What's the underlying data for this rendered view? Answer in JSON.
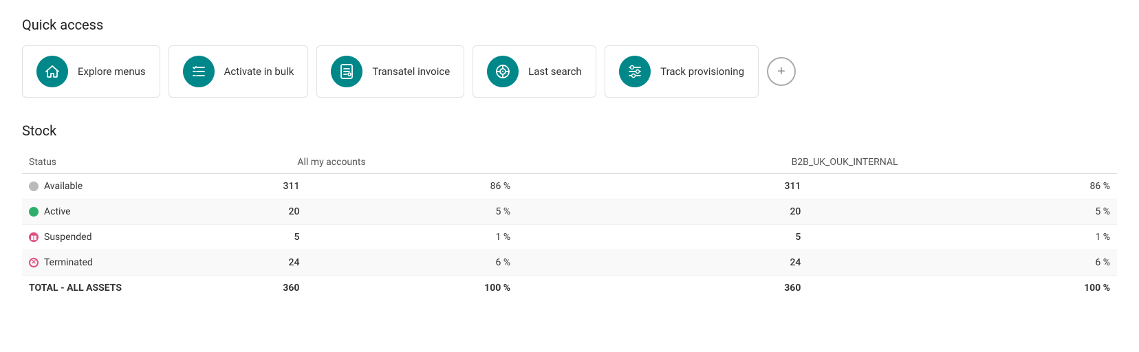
{
  "quickAccess": {
    "title": "Quick access",
    "cards": [
      {
        "id": "explore-menus",
        "label": "Explore menus",
        "icon": "home"
      },
      {
        "id": "activate-bulk",
        "label": "Activate in bulk",
        "icon": "list-check"
      },
      {
        "id": "transatel-invoice",
        "label": "Transatel invoice",
        "icon": "invoice"
      },
      {
        "id": "last-search",
        "label": "Last search",
        "icon": "network"
      },
      {
        "id": "track-provisioning",
        "label": "Track provisioning",
        "icon": "sliders"
      }
    ],
    "addButton": "+"
  },
  "stock": {
    "title": "Stock",
    "columns": {
      "status": "Status",
      "allAccounts": "All my accounts",
      "b2b": "B2B_UK_OUK_INTERNAL"
    },
    "rows": [
      {
        "status": "Available",
        "statusType": "gray",
        "num1": "311",
        "pct1": "86 %",
        "num2": "311",
        "pct2": "86 %"
      },
      {
        "status": "Active",
        "statusType": "green",
        "num1": "20",
        "pct1": "5 %",
        "num2": "20",
        "pct2": "5 %"
      },
      {
        "status": "Suspended",
        "statusType": "pause",
        "num1": "5",
        "pct1": "1 %",
        "num2": "5",
        "pct2": "1 %"
      },
      {
        "status": "Terminated",
        "statusType": "x",
        "num1": "24",
        "pct1": "6 %",
        "num2": "24",
        "pct2": "6 %"
      }
    ],
    "total": {
      "label": "TOTAL - ALL ASSETS",
      "num1": "360",
      "pct1": "100 %",
      "num2": "360",
      "pct2": "100 %"
    }
  }
}
